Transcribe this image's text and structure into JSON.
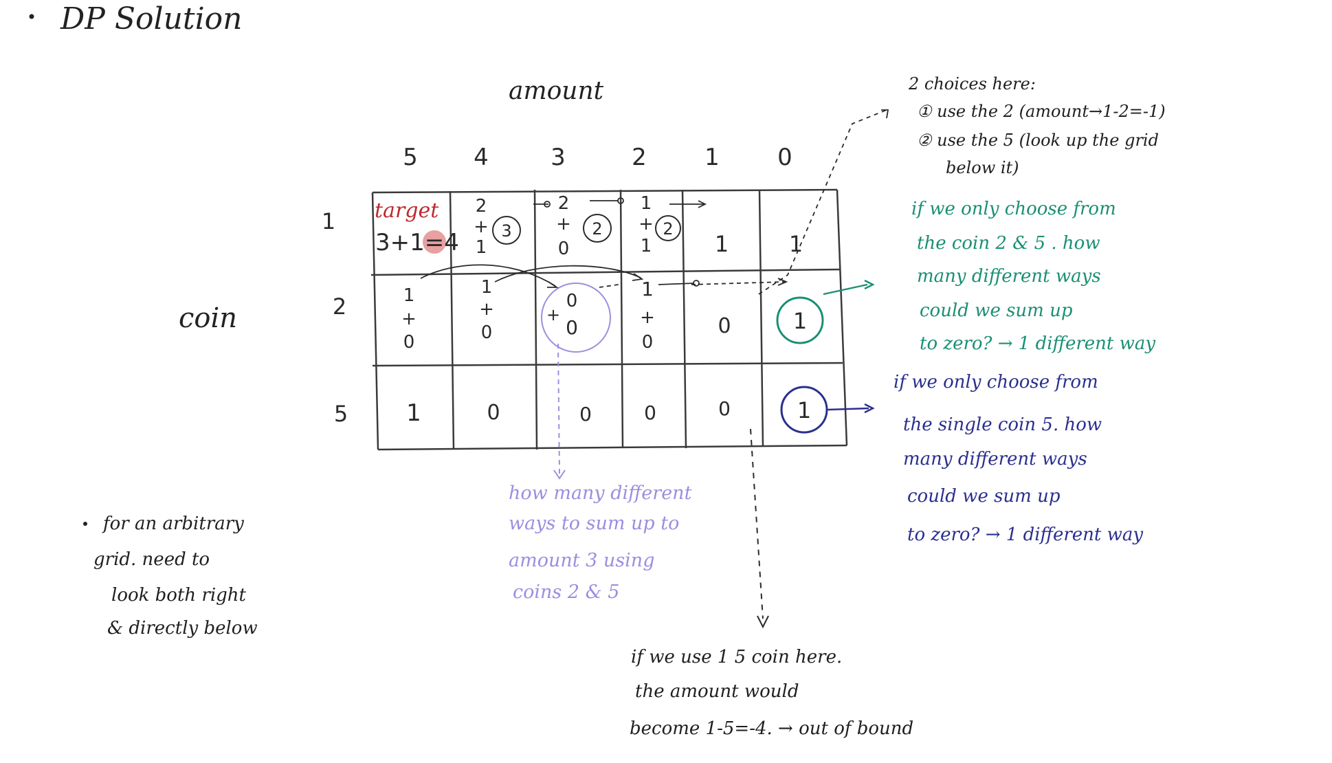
{
  "title": "DP Solution",
  "header_labels": {
    "amount": "amount",
    "coin": "coin"
  },
  "amount_columns": [
    "5",
    "4",
    "3",
    "2",
    "1",
    "0"
  ],
  "coin_rows": [
    "1",
    "2",
    "5"
  ],
  "cells": {
    "r0": [
      {
        "top": "target",
        "lines": [
          "3+1=4"
        ]
      },
      {
        "lines": [
          "2",
          "+",
          "1"
        ],
        "circled": "3"
      },
      {
        "lines": [
          "2",
          "+",
          "0"
        ],
        "circled": "2"
      },
      {
        "lines": [
          "1",
          "+",
          "1"
        ],
        "circled": "2"
      },
      {
        "lines": [
          "1"
        ]
      },
      {
        "lines": [
          "1"
        ]
      }
    ],
    "r1": [
      {
        "lines": [
          "1",
          "+",
          "0"
        ]
      },
      {
        "lines": [
          "1",
          "+",
          "0"
        ]
      },
      {
        "lines": [
          "+",
          "0",
          "0"
        ]
      },
      {
        "lines": [
          "1",
          "+",
          "0"
        ]
      },
      {
        "lines": [
          "0"
        ]
      },
      {
        "lines": [
          "1"
        ]
      }
    ],
    "r2": [
      {
        "lines": [
          "1"
        ]
      },
      {
        "lines": [
          "0"
        ]
      },
      {
        "lines": [
          "0"
        ]
      },
      {
        "lines": [
          "0"
        ]
      },
      {
        "lines": [
          "0"
        ]
      },
      {
        "lines": [
          "1"
        ]
      }
    ]
  },
  "notes": {
    "choices": [
      "2 choices here:",
      "① use the 2 (amount→1-2=-1)",
      "② use the 5 (look up the grid",
      "below it)"
    ],
    "teal": [
      "if we only choose from",
      "the coin 2 & 5  . how",
      "many different ways",
      "could we sum up",
      "to zero? → 1 different way"
    ],
    "navy": [
      "if we only choose from",
      "the single coin 5. how",
      "many different ways",
      "could we sum up",
      "to zero? → 1 different way"
    ],
    "purple": [
      "how many different",
      "ways to sum up to",
      "amount 3  using",
      "coins 2 & 5"
    ],
    "bottom": [
      "if we use 1 5 coin here.",
      "the amount would",
      "become  1-5=-4. → out of bound"
    ],
    "left_bullet": [
      "for an arbitrary",
      "grid. need to",
      "look both right",
      "& directly below"
    ]
  },
  "colors": {
    "ink": "#2a2a2a",
    "red": "#c0282d",
    "red_fill": "#e8a0a0",
    "teal": "#1a8f72",
    "navy": "#2a2f8f",
    "purple": "#9a8fe0"
  }
}
